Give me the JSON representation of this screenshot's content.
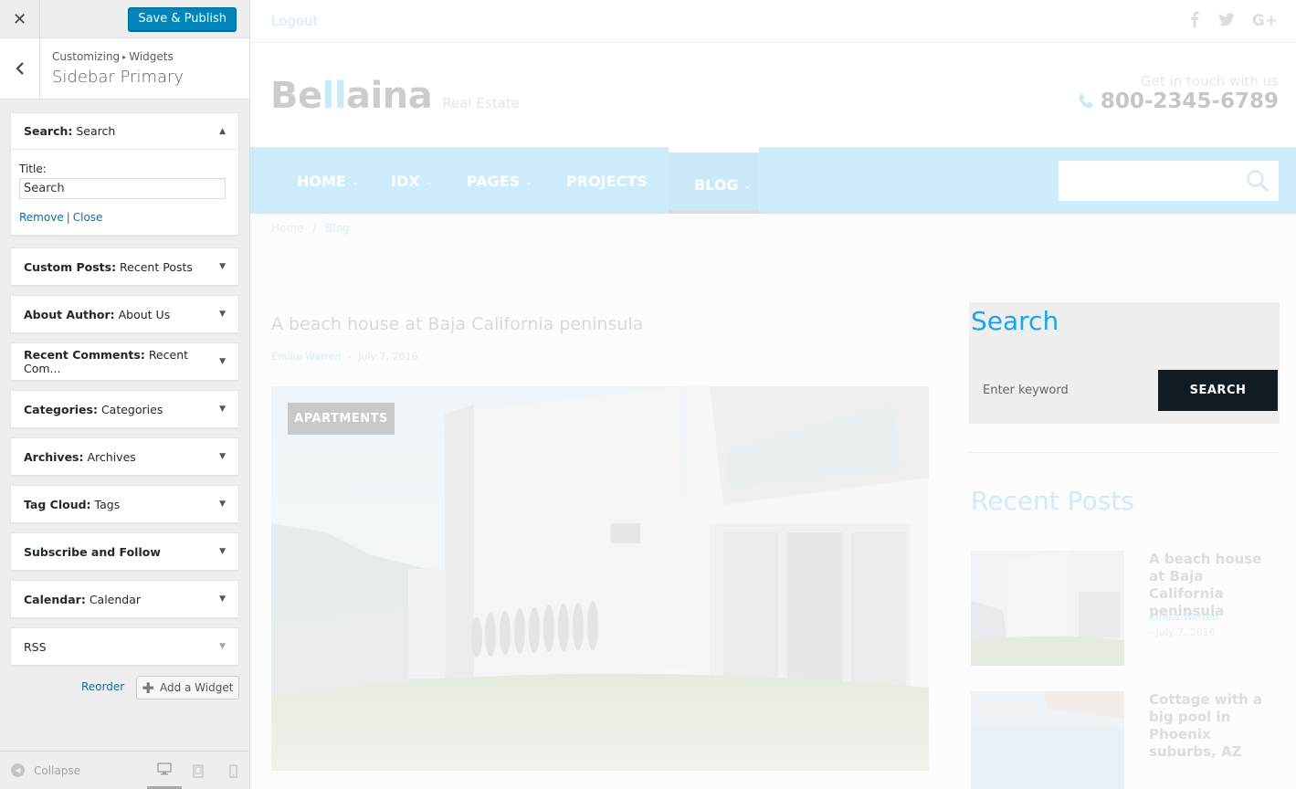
{
  "customizer": {
    "close_icon": "close-icon",
    "save_label": "Save & Publish",
    "breadcrumb": {
      "root": "Customizing",
      "section": "Widgets"
    },
    "panel_title": "Sidebar Primary",
    "open_widget": {
      "name": "Search",
      "title": "Search",
      "field_label": "Title:",
      "field_value": "Search",
      "remove_label": "Remove",
      "separator": "|",
      "close_label": "Close"
    },
    "widgets": [
      {
        "name": "Custom Posts",
        "title": "Recent Posts"
      },
      {
        "name": "About Author",
        "title": "About Us"
      },
      {
        "name": "Recent Comments",
        "title": "Recent Com..."
      },
      {
        "name": "Categories",
        "title": "Categories"
      },
      {
        "name": "Archives",
        "title": "Archives"
      },
      {
        "name": "Tag Cloud",
        "title": "Tags"
      },
      {
        "name": "Subscribe and Follow",
        "title": ""
      },
      {
        "name": "Calendar",
        "title": "Calendar"
      },
      {
        "name": "RSS",
        "title": ""
      }
    ],
    "reorder_label": "Reorder",
    "add_widget_label": "Add a Widget",
    "collapse_label": "Collapse",
    "devices": [
      "desktop-icon",
      "tablet-icon",
      "mobile-icon"
    ],
    "active_device": "desktop",
    "accent": "#0085ba",
    "link_color": "#0073aa"
  },
  "site": {
    "logout": "Logout",
    "social": [
      "facebook-icon",
      "twitter-icon",
      "google-plus-icon"
    ],
    "logo_a": "Be",
    "logo_b": "ll",
    "logo_c": "aina",
    "logo_sub": "Real Estate",
    "contact_label": "Get in touch with us",
    "phone": "800-2345-6789",
    "nav": [
      "HOME",
      "IDX",
      "PAGES",
      "PROJECTS",
      "BLOG"
    ],
    "breadcrumb": {
      "home": "Home",
      "sep": "/",
      "current": "Blog"
    },
    "post": {
      "title": "A beach house at Baja California peninsula",
      "author": "Emilia Warren",
      "dash": "-",
      "date": "July 7, 2016",
      "tag": "APARTMENTS"
    },
    "search_widget": {
      "title": "Search",
      "placeholder": "Enter keyword",
      "button": "SEARCH"
    },
    "recent_posts": {
      "title": "Recent Posts",
      "items": [
        {
          "title": "A beach house at Baja California peninsula",
          "author": "Emilia Warren",
          "date": "- July 7, 2016"
        },
        {
          "title": "Cottage with a big pool in Phoenix suburbs, AZ",
          "author": "",
          "date": ""
        }
      ]
    },
    "brand_color": "#1aa6ee"
  }
}
